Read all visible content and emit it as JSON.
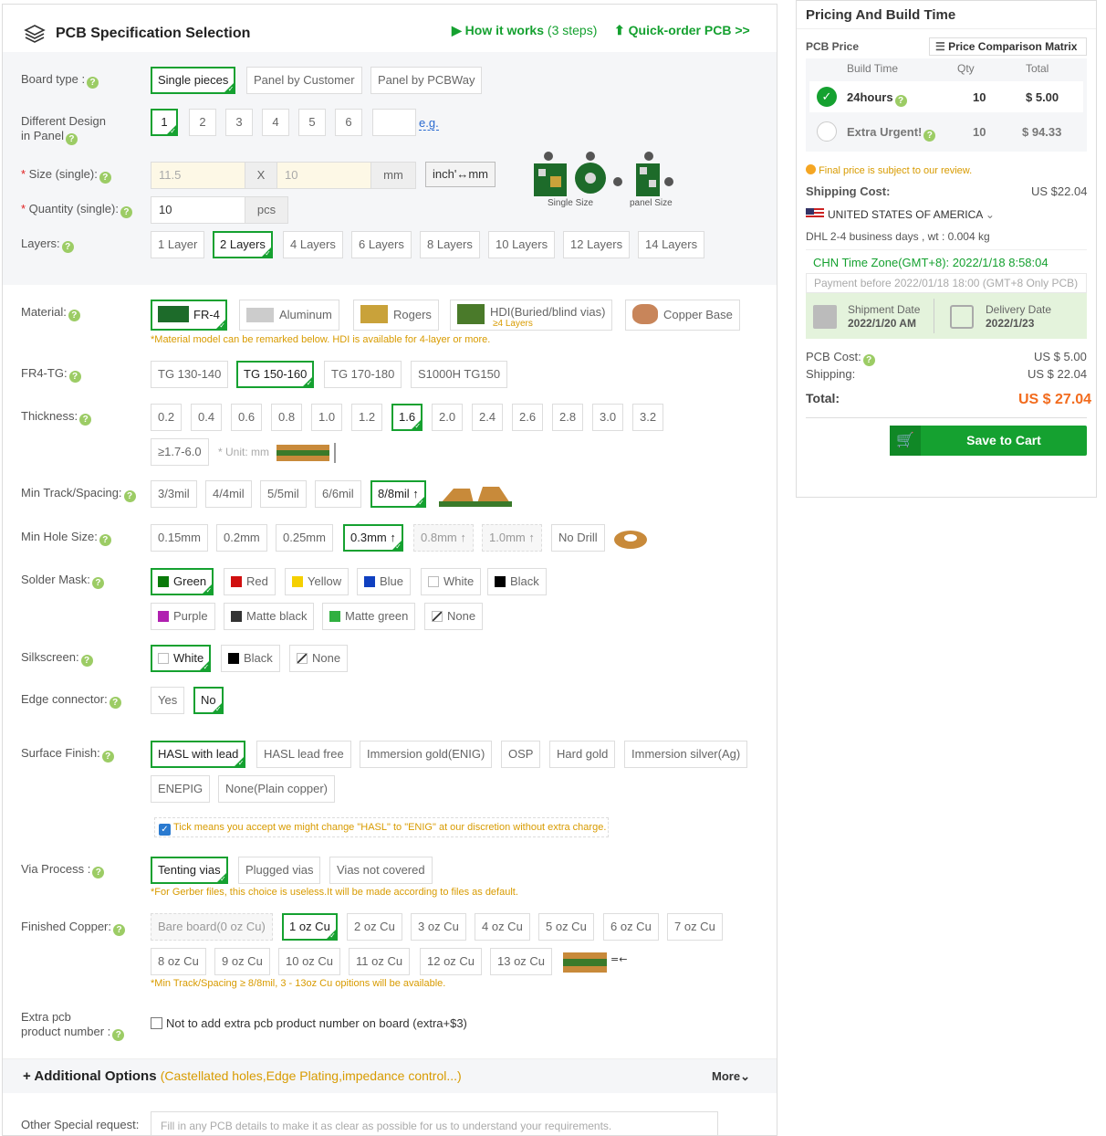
{
  "header": {
    "title": "PCB Specification Selection",
    "how_it_works": "How it works",
    "how_steps": "(3 steps)",
    "quick_order": "Quick-order PCB >>"
  },
  "board_type": {
    "label": "Board type :",
    "options": [
      "Single pieces",
      "Panel by Customer",
      "Panel by PCBWay"
    ]
  },
  "design_panel": {
    "label1": "Different Design",
    "label2": "in Panel",
    "options": [
      "1",
      "2",
      "3",
      "4",
      "5",
      "6"
    ],
    "eg": "e.g."
  },
  "size": {
    "label": "Size (single):",
    "x_placeholder": "11.5",
    "x_sep": "X",
    "y_placeholder": "10",
    "unit": "mm",
    "convert": "inch'↔mm",
    "single_size": "Single Size",
    "panel_size": "panel Size"
  },
  "quantity": {
    "label": "Quantity (single):",
    "value": "10",
    "unit": "pcs"
  },
  "layers": {
    "label": "Layers:",
    "options": [
      "1 Layer",
      "2 Layers",
      "4 Layers",
      "6 Layers",
      "8 Layers",
      "10 Layers",
      "12 Layers",
      "14 Layers"
    ]
  },
  "material": {
    "label": "Material:",
    "options": [
      "FR-4",
      "Aluminum",
      "Rogers",
      "HDI(Buried/blind vias)",
      "Copper Base"
    ],
    "hdi_sub": "≥4 Layers",
    "note": "*Material model can be remarked below. HDI is available for 4-layer or more."
  },
  "tg": {
    "label": "FR4-TG:",
    "options": [
      "TG 130-140",
      "TG 150-160",
      "TG 170-180",
      "S1000H TG150"
    ]
  },
  "thickness": {
    "label": "Thickness:",
    "options": [
      "0.2",
      "0.4",
      "0.6",
      "0.8",
      "1.0",
      "1.2",
      "1.6",
      "2.0",
      "2.4",
      "2.6",
      "2.8",
      "3.0",
      "3.2"
    ],
    "extra": "≥1.7-6.0",
    "unit_note": "* Unit: mm"
  },
  "track": {
    "label": "Min Track/Spacing:",
    "options": [
      "3/3mil",
      "4/4mil",
      "5/5mil",
      "6/6mil",
      "8/8mil ↑"
    ]
  },
  "hole": {
    "label": "Min Hole Size:",
    "options": [
      "0.15mm",
      "0.2mm",
      "0.25mm",
      "0.3mm ↑",
      "0.8mm ↑",
      "1.0mm ↑",
      "No Drill"
    ]
  },
  "mask": {
    "label": "Solder Mask:",
    "options": [
      "Green",
      "Red",
      "Yellow",
      "Blue",
      "White",
      "Black",
      "Purple",
      "Matte black",
      "Matte green",
      "None"
    ],
    "colors": [
      "#0a7a0a",
      "#d01010",
      "#f5d000",
      "#1040c0",
      "#ffffff",
      "#000000",
      "#b020b0",
      "#333333",
      "#30b040",
      "none"
    ]
  },
  "silk": {
    "label": "Silkscreen:",
    "options": [
      "White",
      "Black",
      "None"
    ]
  },
  "edge": {
    "label": "Edge connector:",
    "options": [
      "Yes",
      "No"
    ]
  },
  "finish": {
    "label": "Surface Finish:",
    "options": [
      "HASL with lead",
      "HASL lead free",
      "Immersion gold(ENIG)",
      "OSP",
      "Hard gold",
      "Immersion silver(Ag)",
      "ENEPIG",
      "None(Plain copper)"
    ],
    "tick_note": "Tick means you accept we might change \"HASL\" to \"ENIG\" at our discretion without extra charge."
  },
  "via": {
    "label": "Via Process :",
    "options": [
      "Tenting vias",
      "Plugged vias",
      "Vias not covered"
    ],
    "note": "*For Gerber files, this choice is useless.It will be made according to files as default."
  },
  "copper": {
    "label": "Finished Copper:",
    "options": [
      "Bare board(0 oz Cu)",
      "1 oz Cu",
      "2 oz Cu",
      "3 oz Cu",
      "4 oz Cu",
      "5 oz Cu",
      "6 oz Cu",
      "7 oz Cu",
      "8 oz Cu",
      "9 oz Cu",
      "10 oz Cu",
      "11 oz Cu",
      "12 oz Cu",
      "13 oz Cu"
    ],
    "note": "*Min Track/Spacing ≥ 8/8mil, 3 - 13oz Cu opitions will be available."
  },
  "extra_pcb": {
    "label1": "Extra pcb",
    "label2": "product number :",
    "checkbox": "Not to add extra pcb product number on board (extra+$3)"
  },
  "additional": {
    "title": "Additional Options",
    "sub": "(Castellated holes,Edge Plating,impedance control...)",
    "more": "More"
  },
  "special": {
    "label": "Other Special request:",
    "placeholder": "Fill in any PCB details to make it as clear as possible for us to understand your requirements."
  },
  "pricing": {
    "title": "Pricing And Build Time",
    "pcb_price": "PCB Price",
    "matrix": "Price Comparison Matrix",
    "cols": [
      "Build Time",
      "Qty",
      "Total"
    ],
    "rows": [
      {
        "time": "24hours",
        "qty": "10",
        "total": "$ 5.00"
      },
      {
        "time": "Extra Urgent!",
        "qty": "10",
        "total": "$ 94.33"
      }
    ],
    "review": "Final price is subject to our review.",
    "ship_label": "Shipping Cost:",
    "ship_val": "US $22.04",
    "country": "UNITED STATES OF AMERICA",
    "dhl": "DHL   2-4 business days ,   wt : 0.004 kg",
    "tz": "CHN Time Zone(GMT+8): 2022/1/18 8:58:04",
    "pay_before": "Payment before 2022/01/18 18:00 (GMT+8 Only PCB)",
    "ship_date_l": "Shipment Date",
    "ship_date": "2022/1/20 AM",
    "deliv_l": "Delivery Date",
    "deliv": "2022/1/23",
    "pcb_cost_l": "PCB Cost:",
    "pcb_cost": "US $ 5.00",
    "shipping_l": "Shipping:",
    "shipping": "US $ 22.04",
    "total_l": "Total:",
    "total": "US $ 27.04",
    "cart": "Save to Cart",
    "accent": "#15a130",
    "price_orange": "#f26b1d"
  }
}
